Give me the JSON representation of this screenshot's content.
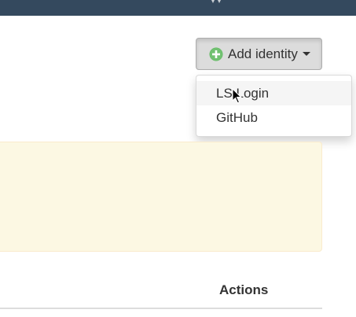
{
  "add_identity": {
    "label": "Add identity",
    "icon": "plus-circle-icon",
    "accent": "#5cb85c"
  },
  "dropdown": {
    "items": [
      {
        "label": "LS Login"
      },
      {
        "label": "GitHub"
      }
    ]
  },
  "table": {
    "columns": [
      "Actions"
    ]
  },
  "colors": {
    "topbar": "#34495e",
    "alert_bg": "#fcf8e3",
    "alert_border": "#faebcc"
  }
}
